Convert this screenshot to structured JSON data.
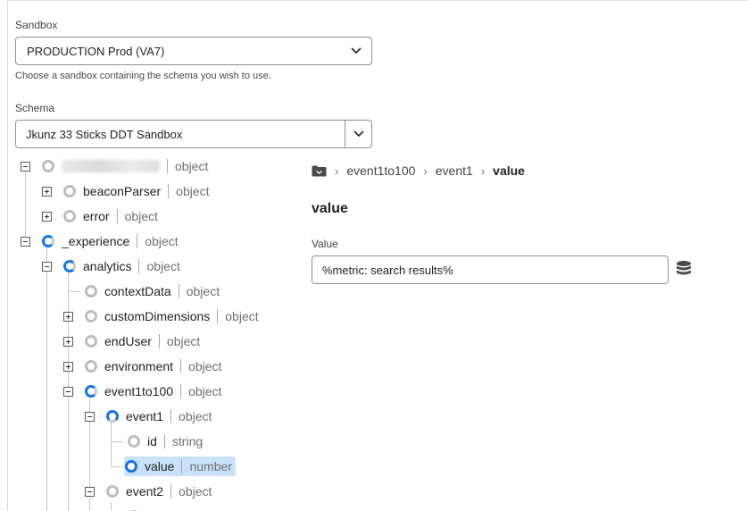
{
  "sandbox": {
    "label": "Sandbox",
    "value": "PRODUCTION Prod (VA7)",
    "help": "Choose a sandbox containing the schema you wish to use."
  },
  "schema": {
    "label": "Schema",
    "value": "Jkunz 33 Sticks DDT Sandbox"
  },
  "tree": {
    "rows": [
      {
        "name": "",
        "type": "object"
      },
      {
        "name": "beaconParser",
        "type": "object"
      },
      {
        "name": "error",
        "type": "object"
      },
      {
        "name": "_experience",
        "type": "object"
      },
      {
        "name": "analytics",
        "type": "object"
      },
      {
        "name": "contextData",
        "type": "object"
      },
      {
        "name": "customDimensions",
        "type": "object"
      },
      {
        "name": "endUser",
        "type": "object"
      },
      {
        "name": "environment",
        "type": "object"
      },
      {
        "name": "event1to100",
        "type": "object"
      },
      {
        "name": "event1",
        "type": "object"
      },
      {
        "name": "id",
        "type": "string"
      },
      {
        "name": "value",
        "type": "number"
      },
      {
        "name": "event2",
        "type": "object"
      }
    ]
  },
  "breadcrumb": [
    "event1to100",
    "event1",
    "value"
  ],
  "detail": {
    "title": "value",
    "value_label": "Value",
    "value": "%metric: search results%"
  },
  "icons": {
    "folder": "folder-icon",
    "database": "data-element-icon",
    "chevron": "chevron-down-icon"
  },
  "colors": {
    "accent": "#1473e6",
    "selected_row": "#c8e2fb"
  }
}
